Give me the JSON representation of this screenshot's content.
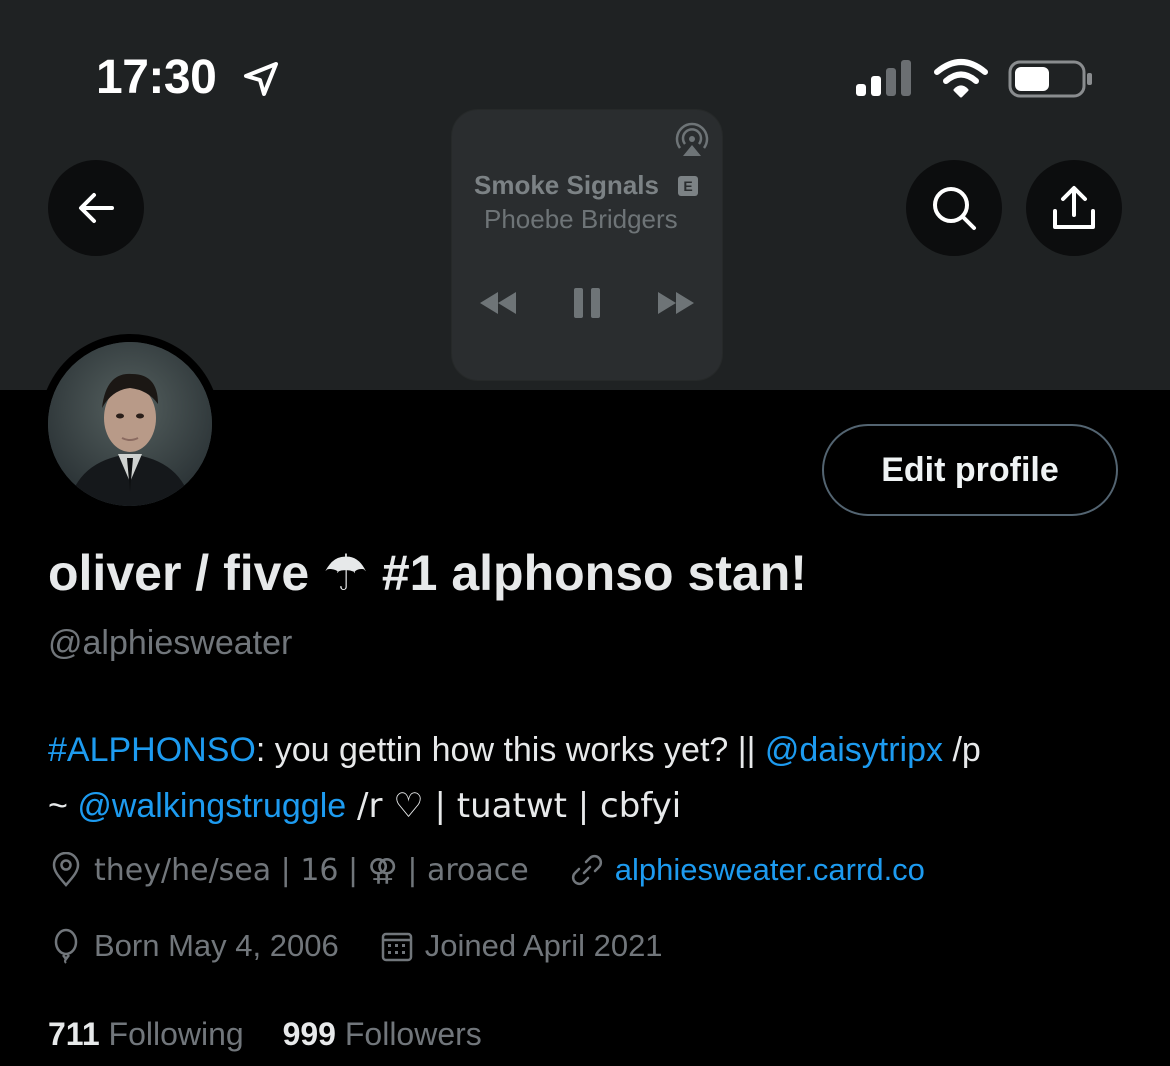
{
  "status_bar": {
    "time": "17:30"
  },
  "now_playing": {
    "title": "Smoke Signals",
    "explicit": "E",
    "artist": "Phoebe Bridgers"
  },
  "header": {
    "back_icon": "arrow-left-icon",
    "search_icon": "search-icon",
    "share_icon": "share-icon"
  },
  "profile": {
    "edit_label": "Edit profile",
    "name_part1": "oliver / five ",
    "name_umbrella": "☂",
    "name_part2": " #1 alphonso stan!",
    "handle": "@alphiesweater",
    "bio": {
      "tag": "#ALPHONSO",
      "t1": ": you gettin how this works yet? || ",
      "m1": "@daisytripx",
      "t2": " /p",
      "t3": "~ ",
      "m2": "@walkingstruggle",
      "t4": " /r ♡ | tuatwt | cbfyi"
    },
    "location": "they/he/sea  | 16 | ⚢ | aroace",
    "website": "alphiesweater.carrd.co",
    "birthday": "Born May 4, 2006",
    "joined": "Joined April 2021",
    "following_count": "711",
    "following_label": "Following",
    "followers_count": "999",
    "followers_label": "Followers"
  },
  "colors": {
    "accent": "#1d9bf0",
    "muted": "#71767b",
    "text": "#e7e9ea"
  }
}
